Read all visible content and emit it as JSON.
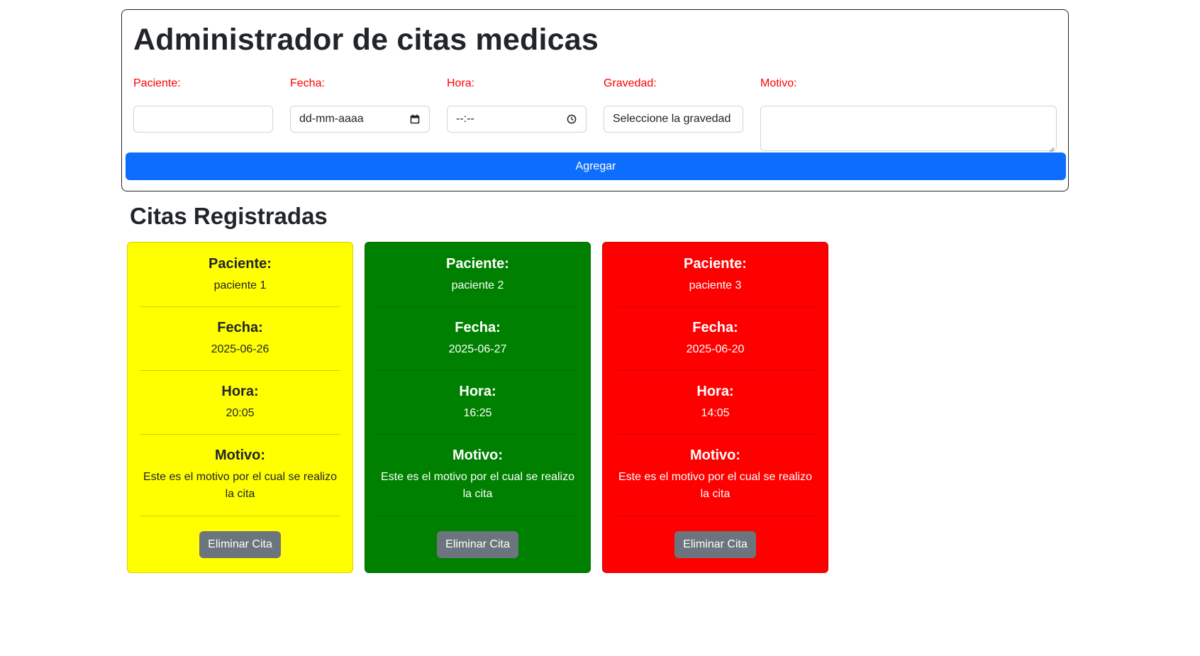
{
  "form": {
    "title": "Administrador de citas medicas",
    "paciente_label": "Paciente:",
    "paciente_value": "",
    "fecha_label": "Fecha:",
    "fecha_placeholder": "dd-mm-aaaa",
    "hora_label": "Hora:",
    "hora_placeholder": "--:--",
    "gravedad_label": "Gravedad:",
    "gravedad_selected": "Seleccione la gravedad",
    "motivo_label": "Motivo:",
    "motivo_value": "",
    "submit_label": "Agregar",
    "label_color": "#ff0000",
    "button_color": "#0d6efd"
  },
  "list": {
    "title": "Citas Registradas",
    "headings": {
      "paciente": "Paciente:",
      "fecha": "Fecha:",
      "hora": "Hora:",
      "motivo": "Motivo:"
    },
    "delete_label": "Eliminar Cita",
    "appointments": [
      {
        "paciente": "paciente 1",
        "fecha": "2025-06-26",
        "hora": "20:05",
        "motivo": "Este es el motivo por el cual se realizo la cita",
        "background": "#ffff00",
        "text_color": "#212529"
      },
      {
        "paciente": "paciente 2",
        "fecha": "2025-06-27",
        "hora": "16:25",
        "motivo": "Este es el motivo por el cual se realizo la cita",
        "background": "#008000",
        "text_color": "#ffffff"
      },
      {
        "paciente": "paciente 3",
        "fecha": "2025-06-20",
        "hora": "14:05",
        "motivo": "Este es el motivo por el cual se realizo la cita",
        "background": "#ff0000",
        "text_color": "#ffffff"
      }
    ]
  }
}
